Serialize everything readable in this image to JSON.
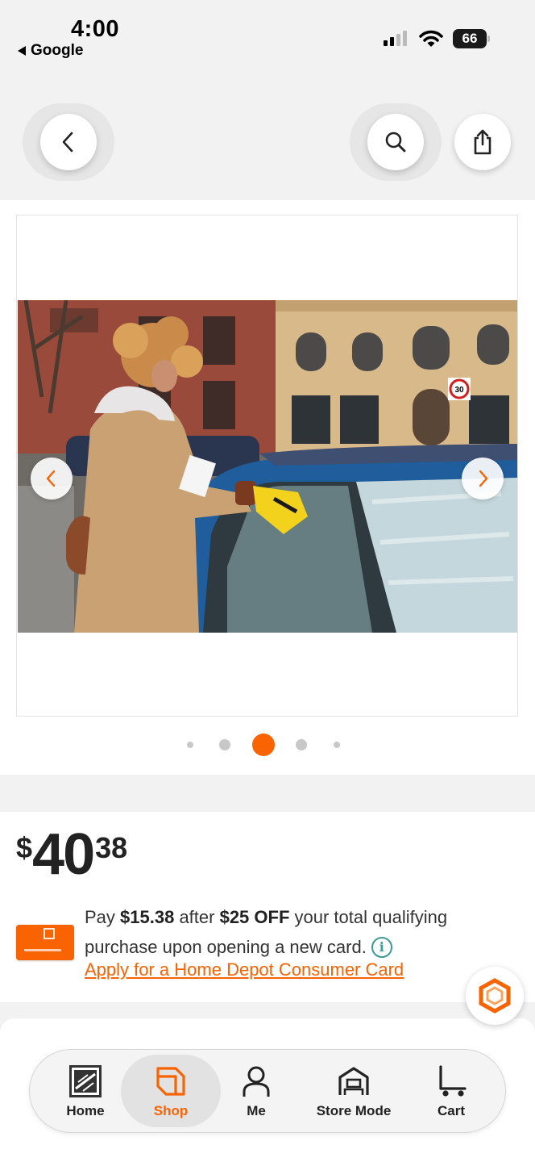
{
  "status_bar": {
    "time": "4:00",
    "back_app": "Google",
    "battery": "66"
  },
  "top_bar": {
    "back_icon": "chevron-left-icon",
    "search_icon": "search-icon",
    "share_icon": "share-icon"
  },
  "gallery": {
    "prev_icon": "chevron-left-icon",
    "next_icon": "chevron-right-icon",
    "dot_count": 5,
    "active_dot": 3,
    "photo_sign": "30",
    "accent": "#f96302"
  },
  "price": {
    "currency": "$",
    "dollars": "40",
    "cents": "38"
  },
  "promo": {
    "text_1": "Pay ",
    "amount": "$15.38",
    "text_2": " after ",
    "discount": "$25 OFF",
    "text_3": " your total qualifying purchase upon opening a new card.",
    "info_icon": "i",
    "apply_link": "Apply for a Home Depot Consumer Card"
  },
  "chat": {
    "icon": "chat-hexagon-icon"
  },
  "tabbar": {
    "tabs": [
      {
        "label": "Home",
        "icon": "home-depot-logo-icon",
        "active": false
      },
      {
        "label": "Shop",
        "icon": "shop-tag-icon",
        "active": true
      },
      {
        "label": "Me",
        "icon": "person-icon",
        "active": false
      },
      {
        "label": "Store Mode",
        "icon": "store-icon",
        "active": false
      },
      {
        "label": "Cart",
        "icon": "cart-icon",
        "active": false
      }
    ]
  }
}
